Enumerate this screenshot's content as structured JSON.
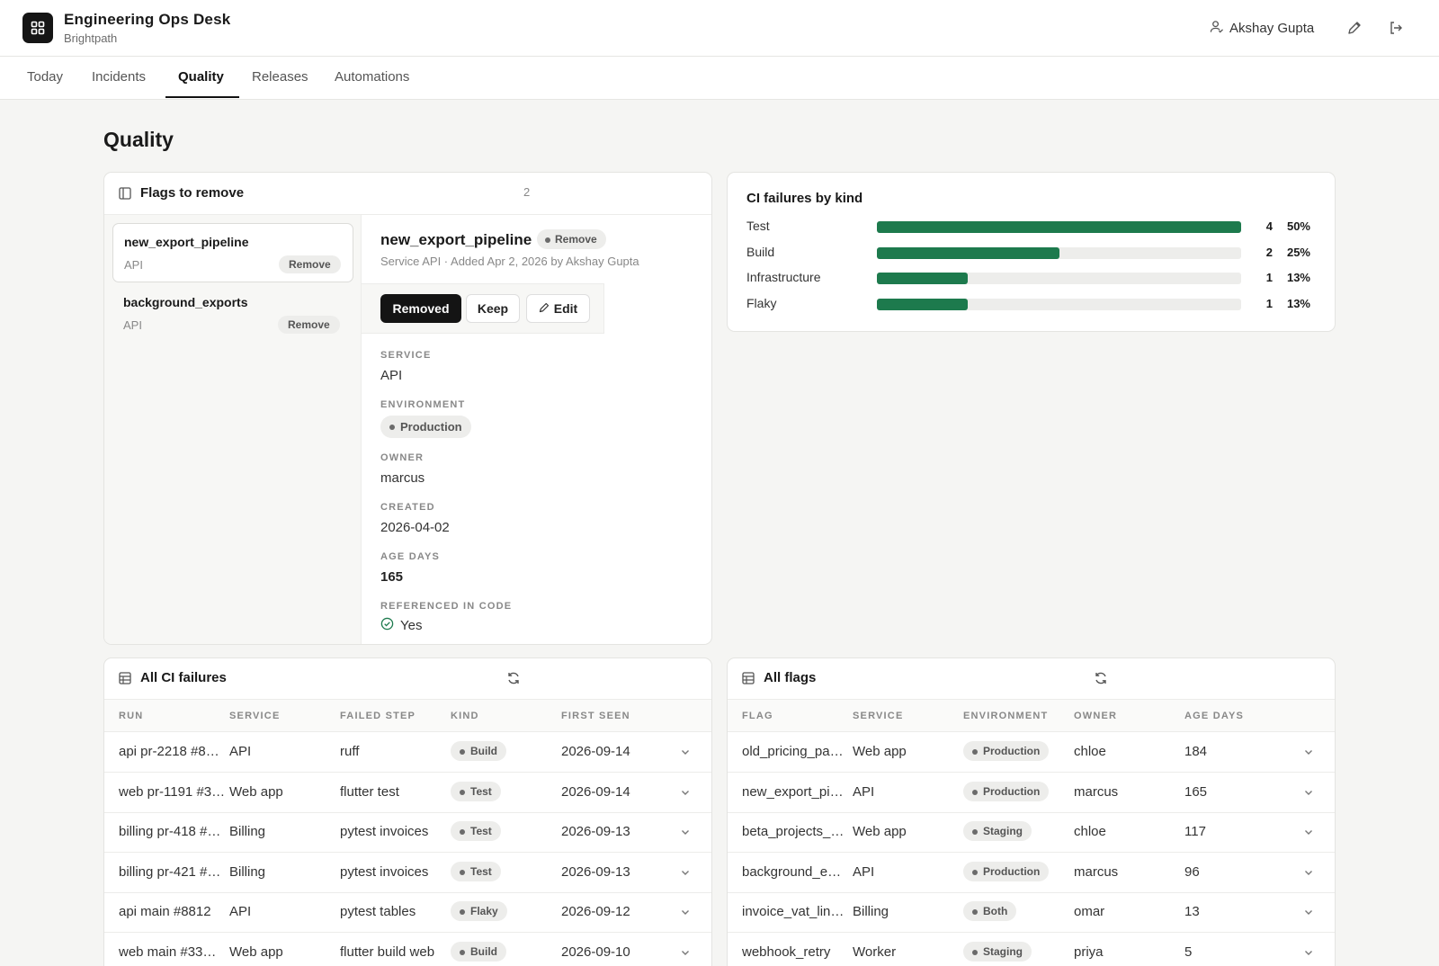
{
  "app": {
    "title": "Engineering Ops Desk",
    "subtitle": "Brightpath",
    "user": "Akshay Gupta"
  },
  "icons": {
    "logo": "grid-icon",
    "user": "user-icon",
    "edit": "pencil-icon",
    "logout": "logout-icon",
    "panel": "panel-icon",
    "table": "table-icon",
    "refresh": "refresh-icon",
    "chevron": "chevron-down-icon",
    "check": "check-circle-icon"
  },
  "tabs": [
    "Today",
    "Incidents",
    "Quality",
    "Releases",
    "Automations"
  ],
  "active_tab": "Quality",
  "page_title": "Quality",
  "flags_panel": {
    "title": "Flags to remove",
    "count": "2",
    "items": [
      {
        "name": "new_export_pipeline",
        "service": "API",
        "tag": "Remove"
      },
      {
        "name": "background_exports",
        "service": "API",
        "tag": "Remove"
      }
    ],
    "detail": {
      "name": "new_export_pipeline",
      "badge": "Remove",
      "meta": "Service API  ·  Added Apr 2, 2026 by Akshay Gupta",
      "actions": {
        "primary": "Removed",
        "secondary": "Keep",
        "edit": "Edit"
      },
      "fields": {
        "service_label": "SERVICE",
        "service": "API",
        "environment_label": "ENVIRONMENT",
        "environment": "Production",
        "owner_label": "OWNER",
        "owner": "marcus",
        "created_label": "CREATED",
        "created": "2026-04-02",
        "age_label": "AGE DAYS",
        "age": "165",
        "ref_label": "REFERENCED IN CODE",
        "ref": "Yes"
      }
    }
  },
  "ci_kind": {
    "title": "CI failures by kind",
    "rows": [
      {
        "label": "Test",
        "count": "4",
        "pct": "50%",
        "fraction": 1.0
      },
      {
        "label": "Build",
        "count": "2",
        "pct": "25%",
        "fraction": 0.5
      },
      {
        "label": "Infrastructure",
        "count": "1",
        "pct": "13%",
        "fraction": 0.25
      },
      {
        "label": "Flaky",
        "count": "1",
        "pct": "13%",
        "fraction": 0.25
      }
    ],
    "bar_color": "#1d7a4d"
  },
  "ci_table": {
    "title": "All CI failures",
    "columns": [
      "RUN",
      "SERVICE",
      "FAILED STEP",
      "KIND",
      "FIRST SEEN"
    ],
    "rows": [
      [
        "api pr-2218 #8…",
        "API",
        "ruff",
        "Build",
        "2026-09-14"
      ],
      [
        "web pr-1191 #3…",
        "Web app",
        "flutter test",
        "Test",
        "2026-09-14"
      ],
      [
        "billing pr-418 #…",
        "Billing",
        "pytest invoices",
        "Test",
        "2026-09-13"
      ],
      [
        "billing pr-421 #…",
        "Billing",
        "pytest invoices",
        "Test",
        "2026-09-13"
      ],
      [
        "api main #8812",
        "API",
        "pytest tables",
        "Flaky",
        "2026-09-12"
      ],
      [
        "web main #33…",
        "Web app",
        "flutter build web",
        "Build",
        "2026-09-10"
      ]
    ]
  },
  "flags_table": {
    "title": "All flags",
    "columns": [
      "FLAG",
      "SERVICE",
      "ENVIRONMENT",
      "OWNER",
      "AGE DAYS"
    ],
    "rows": [
      [
        "old_pricing_pa…",
        "Web app",
        "Production",
        "chloe",
        "184"
      ],
      [
        "new_export_pi…",
        "API",
        "Production",
        "marcus",
        "165"
      ],
      [
        "beta_projects_…",
        "Web app",
        "Staging",
        "chloe",
        "117"
      ],
      [
        "background_e…",
        "API",
        "Production",
        "marcus",
        "96"
      ],
      [
        "invoice_vat_lin…",
        "Billing",
        "Both",
        "omar",
        "13"
      ],
      [
        "webhook_retry",
        "Worker",
        "Staging",
        "priya",
        "5"
      ]
    ]
  }
}
